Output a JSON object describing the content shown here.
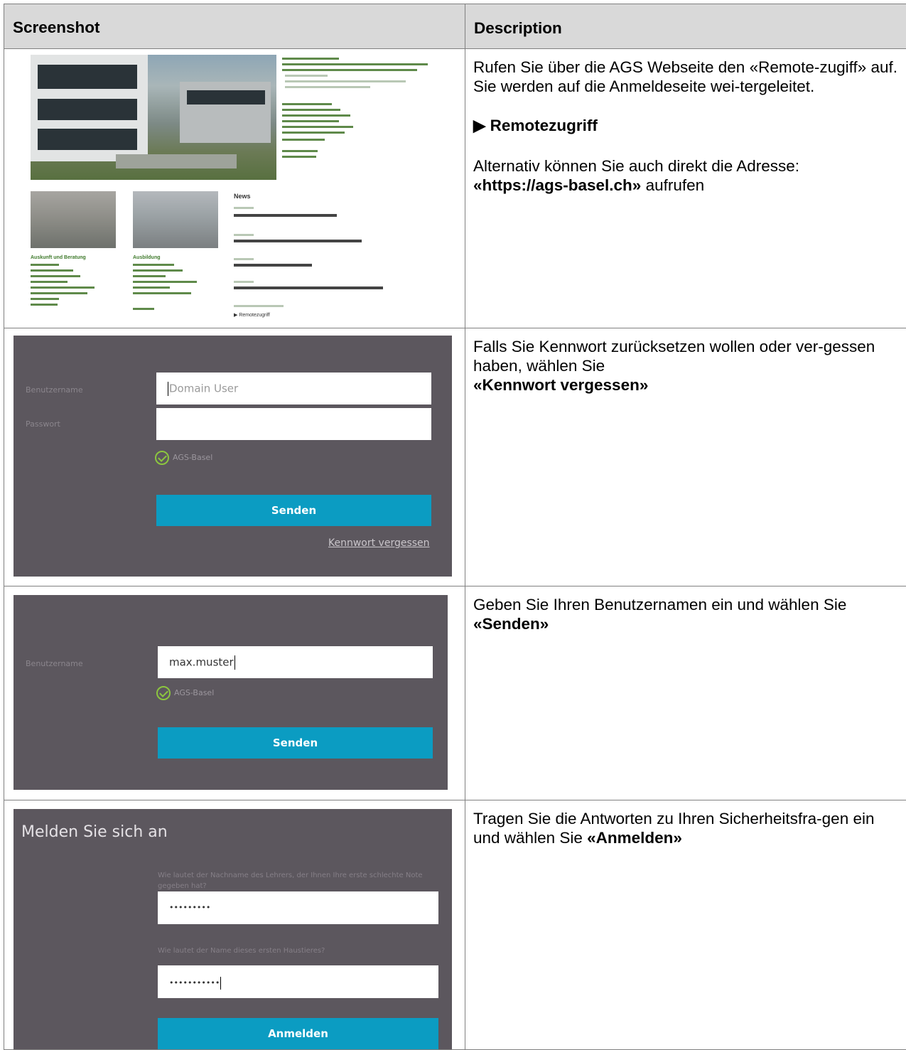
{
  "table": {
    "col1_header": "Screenshot",
    "col2_header": "Description"
  },
  "rows": [
    {
      "text1": "Rufen Sie über die AGS Webseite den «Remote-zugiff» auf. Sie werden auf die Anmeldeseite wei-tergeleitet.",
      "link_arrow": "▶",
      "link_label": "Remotezugriff",
      "text2_pre": "Alternativ können Sie auch direkt die Adresse:",
      "address": "«https://ags-basel.ch»",
      "text2_post": " aufrufen"
    },
    {
      "text_pre": "Falls Sie Kennwort zurücksetzen wollen oder ver-gessen haben, wählen Sie",
      "text_bold": "«Kennwort vergessen»"
    },
    {
      "text_pre": "Geben Sie Ihren Benutzernamen ein und wählen Sie ",
      "text_bold": "«Senden»"
    },
    {
      "text_pre": "Tragen Sie die Antworten zu Ihren Sicherheitsfra-gen ein und wählen Sie ",
      "text_bold": "«Anmelden»"
    }
  ],
  "website_thumbnail": {
    "news_heading": "News",
    "left_heading": "Auskunft und Beratung",
    "middle_heading": "Ausbildung",
    "remote_link": "▶ Remotezugriff"
  },
  "login_forgot": {
    "username_label": "Benutzername",
    "username_placeholder": "Domain User",
    "password_label": "Passwort",
    "domain": "AGS-Basel",
    "submit_label": "Senden",
    "forgot_link": "Kennwort vergessen"
  },
  "login_username": {
    "username_label": "Benutzername",
    "username_value": "max.muster",
    "domain": "AGS-Basel",
    "submit_label": "Senden"
  },
  "login_security": {
    "title": "Melden Sie sich an",
    "question1": "Wie lautet der Nachname des Lehrers, der Ihnen Ihre erste schlechte Note gegeben hat?",
    "answer1": "•••••••••",
    "question2": "Wie lautet der Name dieses ersten Haustieres?",
    "answer2": "•••••••••••",
    "submit_label": "Anmelden"
  },
  "colors": {
    "panel": "#5c575e",
    "button": "#0b9cc2",
    "check": "#8cc63f",
    "header_bg": "#d9d9d9"
  }
}
